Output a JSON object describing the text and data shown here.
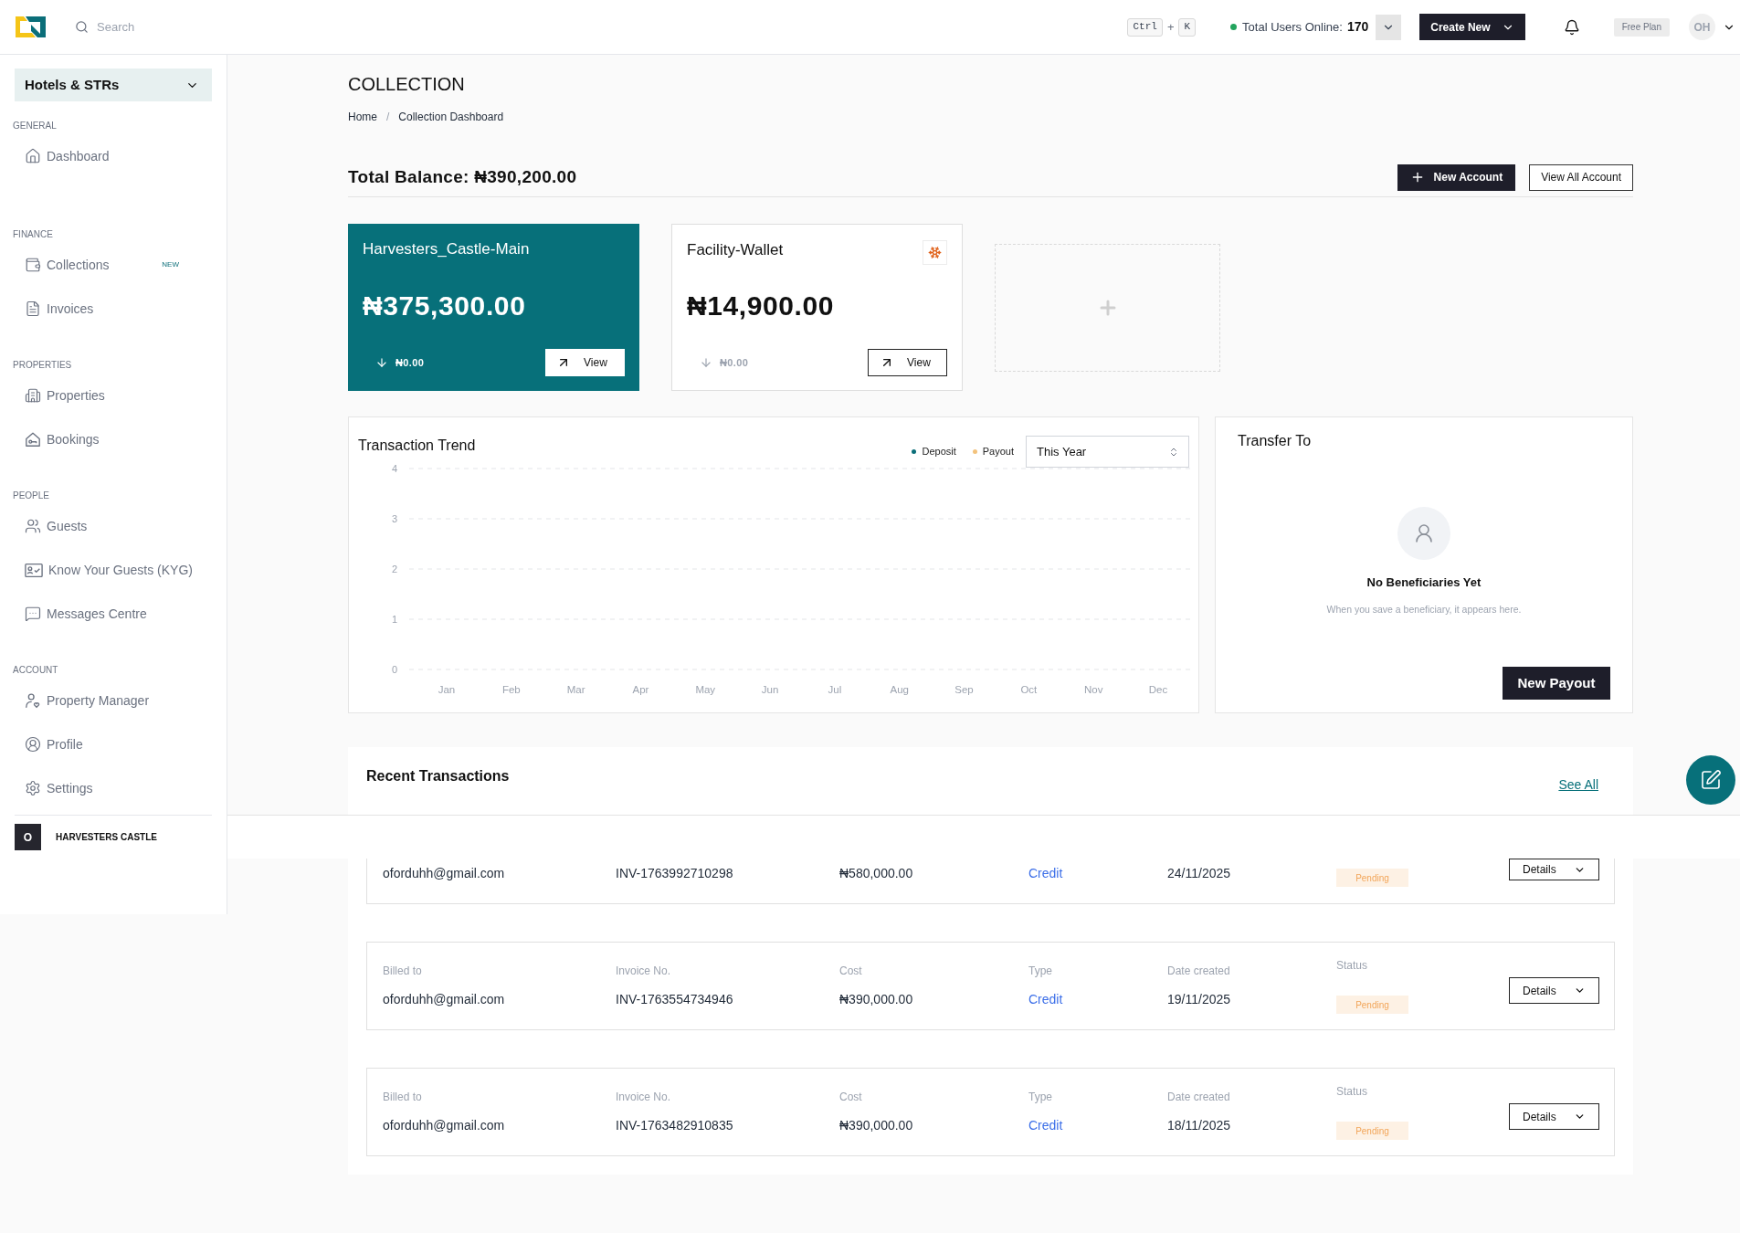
{
  "topbar": {
    "search": {
      "placeholder": "Search"
    },
    "shortcut": {
      "keys": [
        "Ctrl",
        "K"
      ],
      "joiner": "+"
    },
    "users_online": {
      "label": "Total Users Online:",
      "count": "170"
    },
    "create_button": "Create New",
    "plan": "Free Plan",
    "avatar": "OH"
  },
  "sidebar": {
    "workspace": "Hotels & STRs",
    "sections": [
      {
        "title": "GENERAL",
        "items": [
          {
            "label": "Dashboard",
            "selected": false
          }
        ]
      },
      {
        "title": "FINANCE",
        "items": [
          {
            "label": "Collections",
            "badge": "NEW",
            "selected": false
          },
          {
            "label": "Invoices",
            "selected": false
          }
        ]
      },
      {
        "title": "PROPERTIES",
        "items": [
          {
            "label": "Properties",
            "selected": false
          },
          {
            "label": "Bookings",
            "selected": false
          }
        ]
      },
      {
        "title": "PEOPLE",
        "items": [
          {
            "label": "Guests",
            "selected": false
          },
          {
            "label": "Know Your Guests (KYG)",
            "selected": false
          },
          {
            "label": "Messages Centre",
            "selected": false
          }
        ]
      },
      {
        "title": "ACCOUNT",
        "items": [
          {
            "label": "Property Manager",
            "selected": false
          },
          {
            "label": "Profile",
            "selected": false
          },
          {
            "label": "Settings",
            "selected": false
          }
        ]
      }
    ],
    "footer": {
      "initial": "O",
      "name": "HARVESTERS CASTLE"
    }
  },
  "page": {
    "title": "COLLECTION",
    "breadcrumb": {
      "items": [
        "Home",
        "Collection Dashboard"
      ],
      "separator": "/"
    }
  },
  "balance": {
    "text": "Total Balance: ₦390,200.00",
    "actions": [
      {
        "label": "New Account",
        "kind": "primary"
      },
      {
        "label": "View All Account",
        "kind": "outline"
      }
    ]
  },
  "accounts": [
    {
      "kind": "primary",
      "name": "Harvesters_Castle-Main",
      "balance": "₦375,300.00",
      "inflow": "₦0.00",
      "action": "View"
    },
    {
      "kind": "standard",
      "name": "Facility-Wallet",
      "balance": "₦14,900.00",
      "inflow": "₦0.00",
      "action": "View"
    }
  ],
  "trend": {
    "title": "Transaction Trend",
    "legend": [
      {
        "label": "Deposit",
        "color": "#0b6e79"
      },
      {
        "label": "Payout",
        "color": "#f3c27c"
      }
    ],
    "period": {
      "value": "This Year"
    },
    "chart_data": {
      "type": "line",
      "categories": [
        "Jan",
        "Feb",
        "Mar",
        "Apr",
        "May",
        "Jun",
        "Jul",
        "Aug",
        "Sep",
        "Oct",
        "Nov",
        "Dec"
      ],
      "ylim": [
        0,
        4
      ],
      "yticks": [
        0,
        1,
        2,
        3,
        4
      ],
      "grid": true
    }
  },
  "transfer": {
    "title": "Transfer To",
    "empty_title": "No Beneficiaries Yet",
    "empty_message": "When you save a beneficiary, it appears here.",
    "button": "New Payout"
  },
  "transactions": {
    "title": "Recent Transactions",
    "link": "See All",
    "rows": [
      {
        "fields": [
          {
            "kind": "text",
            "value": "oforduhh@gmail.com"
          },
          {
            "kind": "text",
            "value": "INV-1763992710298"
          },
          {
            "kind": "text",
            "value": "₦580,000.00"
          },
          {
            "kind": "type",
            "value": "Credit"
          },
          {
            "kind": "text",
            "value": "24/11/2025"
          },
          {
            "kind": "status",
            "value": "Pending"
          }
        ],
        "action": "Details"
      },
      {
        "fields": [
          {
            "kind": "text",
            "label": "Billed to",
            "value": "oforduhh@gmail.com"
          },
          {
            "kind": "text",
            "label": "Invoice No.",
            "value": "INV-1763554734946"
          },
          {
            "kind": "text",
            "label": "Cost",
            "value": "₦390,000.00"
          },
          {
            "kind": "type",
            "label": "Type",
            "value": "Credit"
          },
          {
            "kind": "text",
            "label": "Date created",
            "value": "19/11/2025"
          },
          {
            "kind": "status",
            "label": "Status",
            "value": "Pending"
          }
        ],
        "action": "Details"
      },
      {
        "fields": [
          {
            "kind": "text",
            "label": "Billed to",
            "value": "oforduhh@gmail.com"
          },
          {
            "kind": "text",
            "label": "Invoice No.",
            "value": "INV-1763482910835"
          },
          {
            "kind": "text",
            "label": "Cost",
            "value": "₦390,000.00"
          },
          {
            "kind": "type",
            "label": "Type",
            "value": "Credit"
          },
          {
            "kind": "text",
            "label": "Date created",
            "value": "18/11/2025"
          },
          {
            "kind": "status",
            "label": "Status",
            "value": "Pending"
          }
        ],
        "action": "Details"
      }
    ]
  }
}
